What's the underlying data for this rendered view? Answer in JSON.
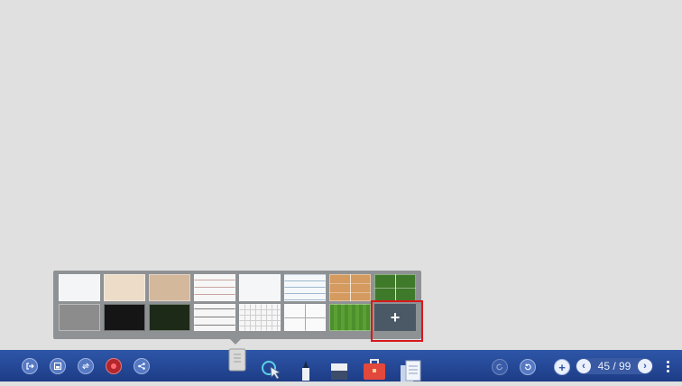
{
  "background_panel": {
    "swatches": [
      {
        "name": "white"
      },
      {
        "name": "cream"
      },
      {
        "name": "tan"
      },
      {
        "name": "lined-paper"
      },
      {
        "name": "plain-white"
      },
      {
        "name": "ruled-blue"
      },
      {
        "name": "basketball-court"
      },
      {
        "name": "soccer-field"
      },
      {
        "name": "gray"
      },
      {
        "name": "black"
      },
      {
        "name": "dark-green"
      },
      {
        "name": "music-staff"
      },
      {
        "name": "grid-paper"
      },
      {
        "name": "cross-axes"
      },
      {
        "name": "field-green"
      }
    ],
    "add_label": "+"
  },
  "toolbar": {
    "left_icons": [
      "exit-icon",
      "save-icon",
      "switch-icon",
      "record-icon",
      "share-icon"
    ],
    "center_icons": [
      "background-icon",
      "select-icon",
      "pen-icon",
      "eraser-icon",
      "toolbox-icon",
      "pages-icon"
    ],
    "undo_icon": "undo-icon",
    "redo_icon": "redo-icon",
    "add_page_label": "+",
    "page_indicator": "45 / 99",
    "prev_label": "‹",
    "next_label": "›"
  },
  "colors": {
    "canvas": "#dfe0df",
    "toolbar": "#2e56a8",
    "highlight": "#d8181c",
    "panel": "#8f9294"
  }
}
